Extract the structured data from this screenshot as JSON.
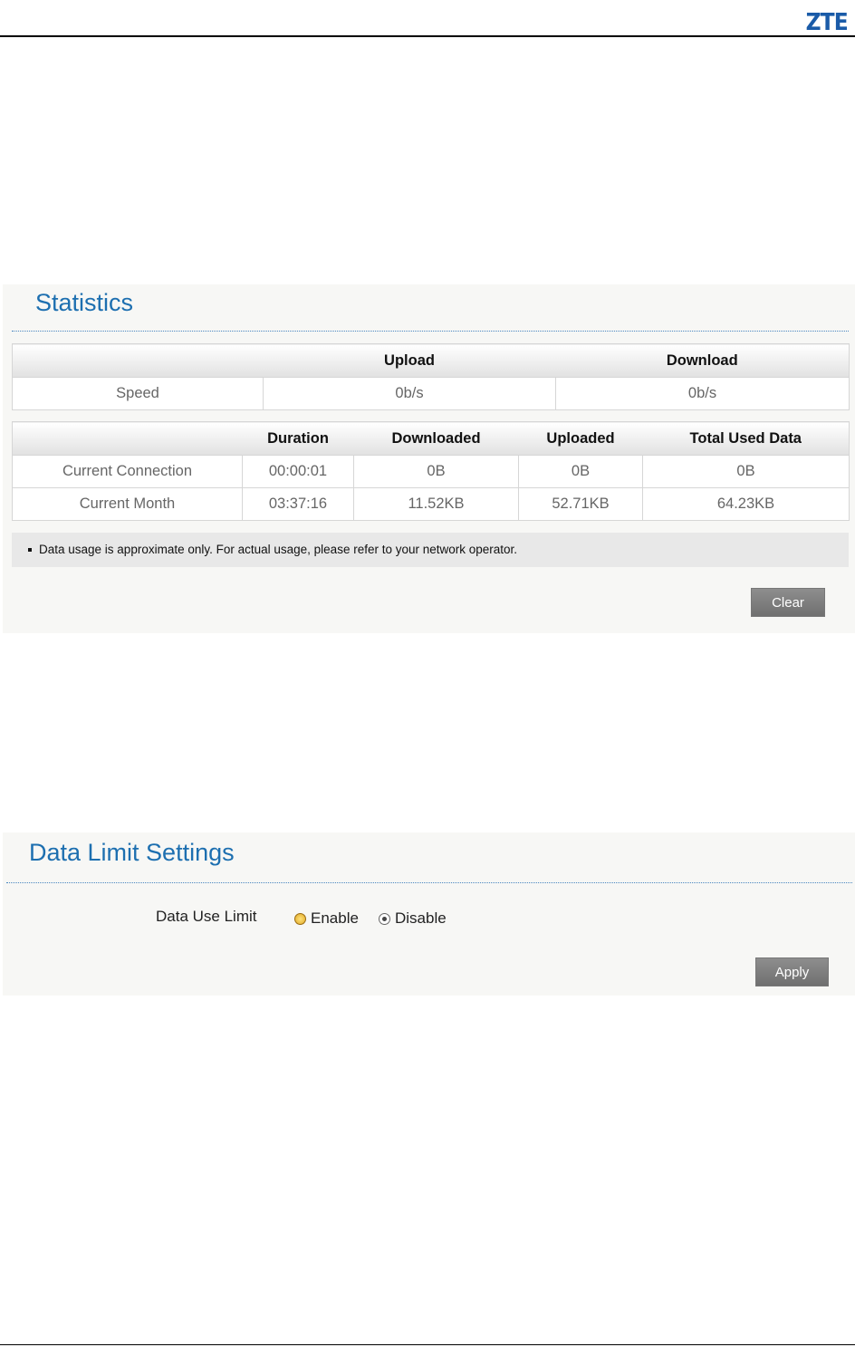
{
  "brand": {
    "logo_text": "ZTE"
  },
  "statistics": {
    "title": "Statistics",
    "speed_table": {
      "headers": [
        "",
        "Upload",
        "Download"
      ],
      "rows": [
        [
          "Speed",
          "0b/s",
          "0b/s"
        ]
      ]
    },
    "usage_table": {
      "headers": [
        "",
        "Duration",
        "Downloaded",
        "Uploaded",
        "Total Used Data"
      ],
      "rows": [
        [
          "Current Connection",
          "00:00:01",
          "0B",
          "0B",
          "0B"
        ],
        [
          "Current Month",
          "03:37:16",
          "11.52KB",
          "52.71KB",
          "64.23KB"
        ]
      ]
    },
    "note": "Data usage is approximate only. For actual usage, please refer to your network operator.",
    "clear_label": "Clear"
  },
  "data_limit": {
    "title": "Data Limit Settings",
    "field_label": "Data Use Limit",
    "options": [
      "Enable",
      "Disable"
    ],
    "selected": "Disable",
    "apply_label": "Apply"
  },
  "colors": {
    "accent": "#1d6fb0",
    "logo": "#1a5ba8"
  }
}
